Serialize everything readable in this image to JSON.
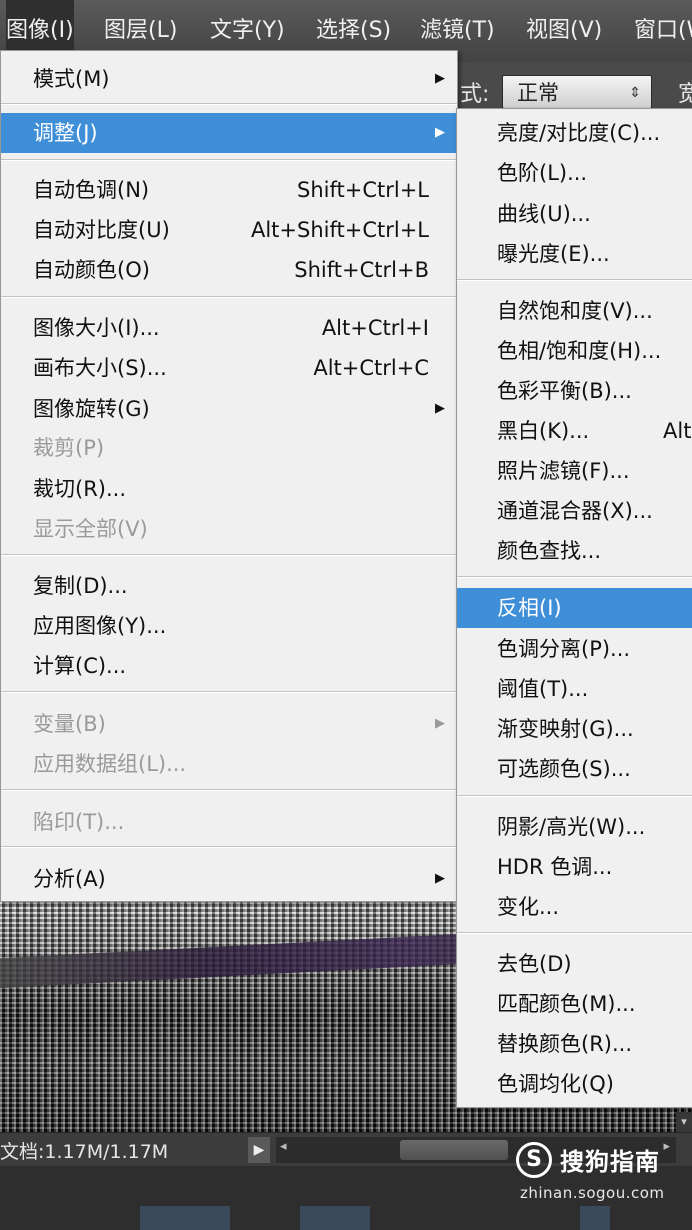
{
  "menubar": {
    "items": [
      {
        "label": "图像(I)"
      },
      {
        "label": "图层(L)"
      },
      {
        "label": "文字(Y)"
      },
      {
        "label": "选择(S)"
      },
      {
        "label": "滤镜(T)"
      },
      {
        "label": "视图(V)"
      },
      {
        "label": "窗口(W)"
      }
    ]
  },
  "options_bar": {
    "mode_label": "式:",
    "mode_value": "正常",
    "extra_label": "宽"
  },
  "image_menu": {
    "items": [
      {
        "label": "模式(M)",
        "shortcut": "",
        "submenu": true,
        "disabled": false
      },
      {
        "label": "调整(J)",
        "shortcut": "",
        "submenu": true,
        "disabled": false,
        "highlighted": true
      },
      {
        "label": "自动色调(N)",
        "shortcut": "Shift+Ctrl+L"
      },
      {
        "label": "自动对比度(U)",
        "shortcut": "Alt+Shift+Ctrl+L"
      },
      {
        "label": "自动颜色(O)",
        "shortcut": "Shift+Ctrl+B"
      },
      {
        "label": "图像大小(I)...",
        "shortcut": "Alt+Ctrl+I"
      },
      {
        "label": "画布大小(S)...",
        "shortcut": "Alt+Ctrl+C"
      },
      {
        "label": "图像旋转(G)",
        "shortcut": "",
        "submenu": true
      },
      {
        "label": "裁剪(P)",
        "shortcut": "",
        "disabled": true
      },
      {
        "label": "裁切(R)...",
        "shortcut": ""
      },
      {
        "label": "显示全部(V)",
        "shortcut": "",
        "disabled": true
      },
      {
        "label": "复制(D)...",
        "shortcut": ""
      },
      {
        "label": "应用图像(Y)...",
        "shortcut": ""
      },
      {
        "label": "计算(C)...",
        "shortcut": ""
      },
      {
        "label": "变量(B)",
        "shortcut": "",
        "submenu": true,
        "disabled": true
      },
      {
        "label": "应用数据组(L)...",
        "shortcut": "",
        "disabled": true
      },
      {
        "label": "陷印(T)...",
        "shortcut": "",
        "disabled": true
      },
      {
        "label": "分析(A)",
        "shortcut": "",
        "submenu": true
      }
    ]
  },
  "adjust_menu": {
    "items": [
      {
        "label": "亮度/对比度(C)..."
      },
      {
        "label": "色阶(L)..."
      },
      {
        "label": "曲线(U)..."
      },
      {
        "label": "曝光度(E)..."
      },
      {
        "label": "自然饱和度(V)..."
      },
      {
        "label": "色相/饱和度(H)..."
      },
      {
        "label": "色彩平衡(B)..."
      },
      {
        "label": "黑白(K)...",
        "shortcut": "Alt"
      },
      {
        "label": "照片滤镜(F)..."
      },
      {
        "label": "通道混合器(X)..."
      },
      {
        "label": "颜色查找..."
      },
      {
        "label": "反相(I)",
        "highlighted": true
      },
      {
        "label": "色调分离(P)..."
      },
      {
        "label": "阈值(T)..."
      },
      {
        "label": "渐变映射(G)..."
      },
      {
        "label": "可选颜色(S)..."
      },
      {
        "label": "阴影/高光(W)..."
      },
      {
        "label": "HDR 色调..."
      },
      {
        "label": "变化..."
      },
      {
        "label": "去色(D)"
      },
      {
        "label": "匹配颜色(M)..."
      },
      {
        "label": "替换颜色(R)..."
      },
      {
        "label": "色调均化(Q)"
      }
    ]
  },
  "status_bar": {
    "doc_info": "文档:1.17M/1.17M"
  },
  "watermark": {
    "logo_letter": "S",
    "brand": "搜狗指南",
    "url": "zhinan.sogou.com"
  },
  "colors": {
    "highlight": "#3f8ed8",
    "menu_bg": "#f0f0f0",
    "menubar_bg": "#4a4a4a"
  }
}
